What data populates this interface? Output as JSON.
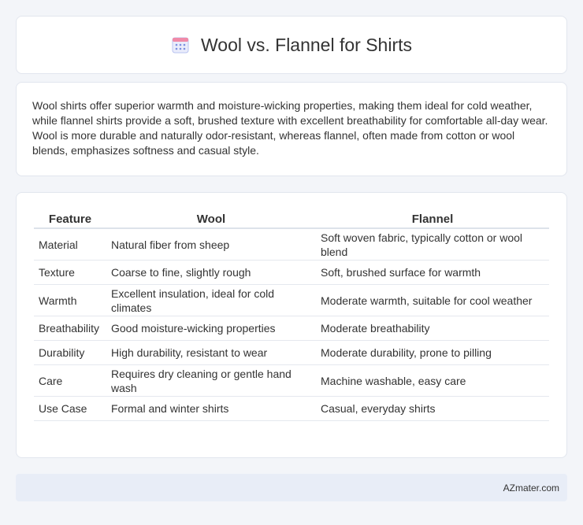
{
  "header": {
    "title": "Wool vs. Flannel for Shirts",
    "icon": "calendar-icon"
  },
  "summary": {
    "text": "Wool shirts offer superior warmth and moisture-wicking properties, making them ideal for cold weather, while flannel shirts provide a soft, brushed texture with excellent breathability for comfortable all-day wear. Wool is more durable and naturally odor-resistant, whereas flannel, often made from cotton or wool blends, emphasizes softness and casual style."
  },
  "table": {
    "headers": [
      "Feature",
      "Wool",
      "Flannel"
    ],
    "rows": [
      [
        "Material",
        "Natural fiber from sheep",
        "Soft woven fabric, typically cotton or wool blend"
      ],
      [
        "Texture",
        "Coarse to fine, slightly rough",
        "Soft, brushed surface for warmth"
      ],
      [
        "Warmth",
        "Excellent insulation, ideal for cold climates",
        "Moderate warmth, suitable for cool weather"
      ],
      [
        "Breathability",
        "Good moisture-wicking properties",
        "Moderate breathability"
      ],
      [
        "Durability",
        "High durability, resistant to wear",
        "Moderate durability, prone to pilling"
      ],
      [
        "Care",
        "Requires dry cleaning or gentle hand wash",
        "Machine washable, easy care"
      ],
      [
        "Use Case",
        "Formal and winter shirts",
        "Casual, everyday shirts"
      ]
    ]
  },
  "footer": {
    "brand": "AZmater.com"
  },
  "colors": {
    "background": "#f3f5f9",
    "card": "#ffffff",
    "footer": "#e8edf7",
    "icon_accent": "#7b8fe0"
  }
}
